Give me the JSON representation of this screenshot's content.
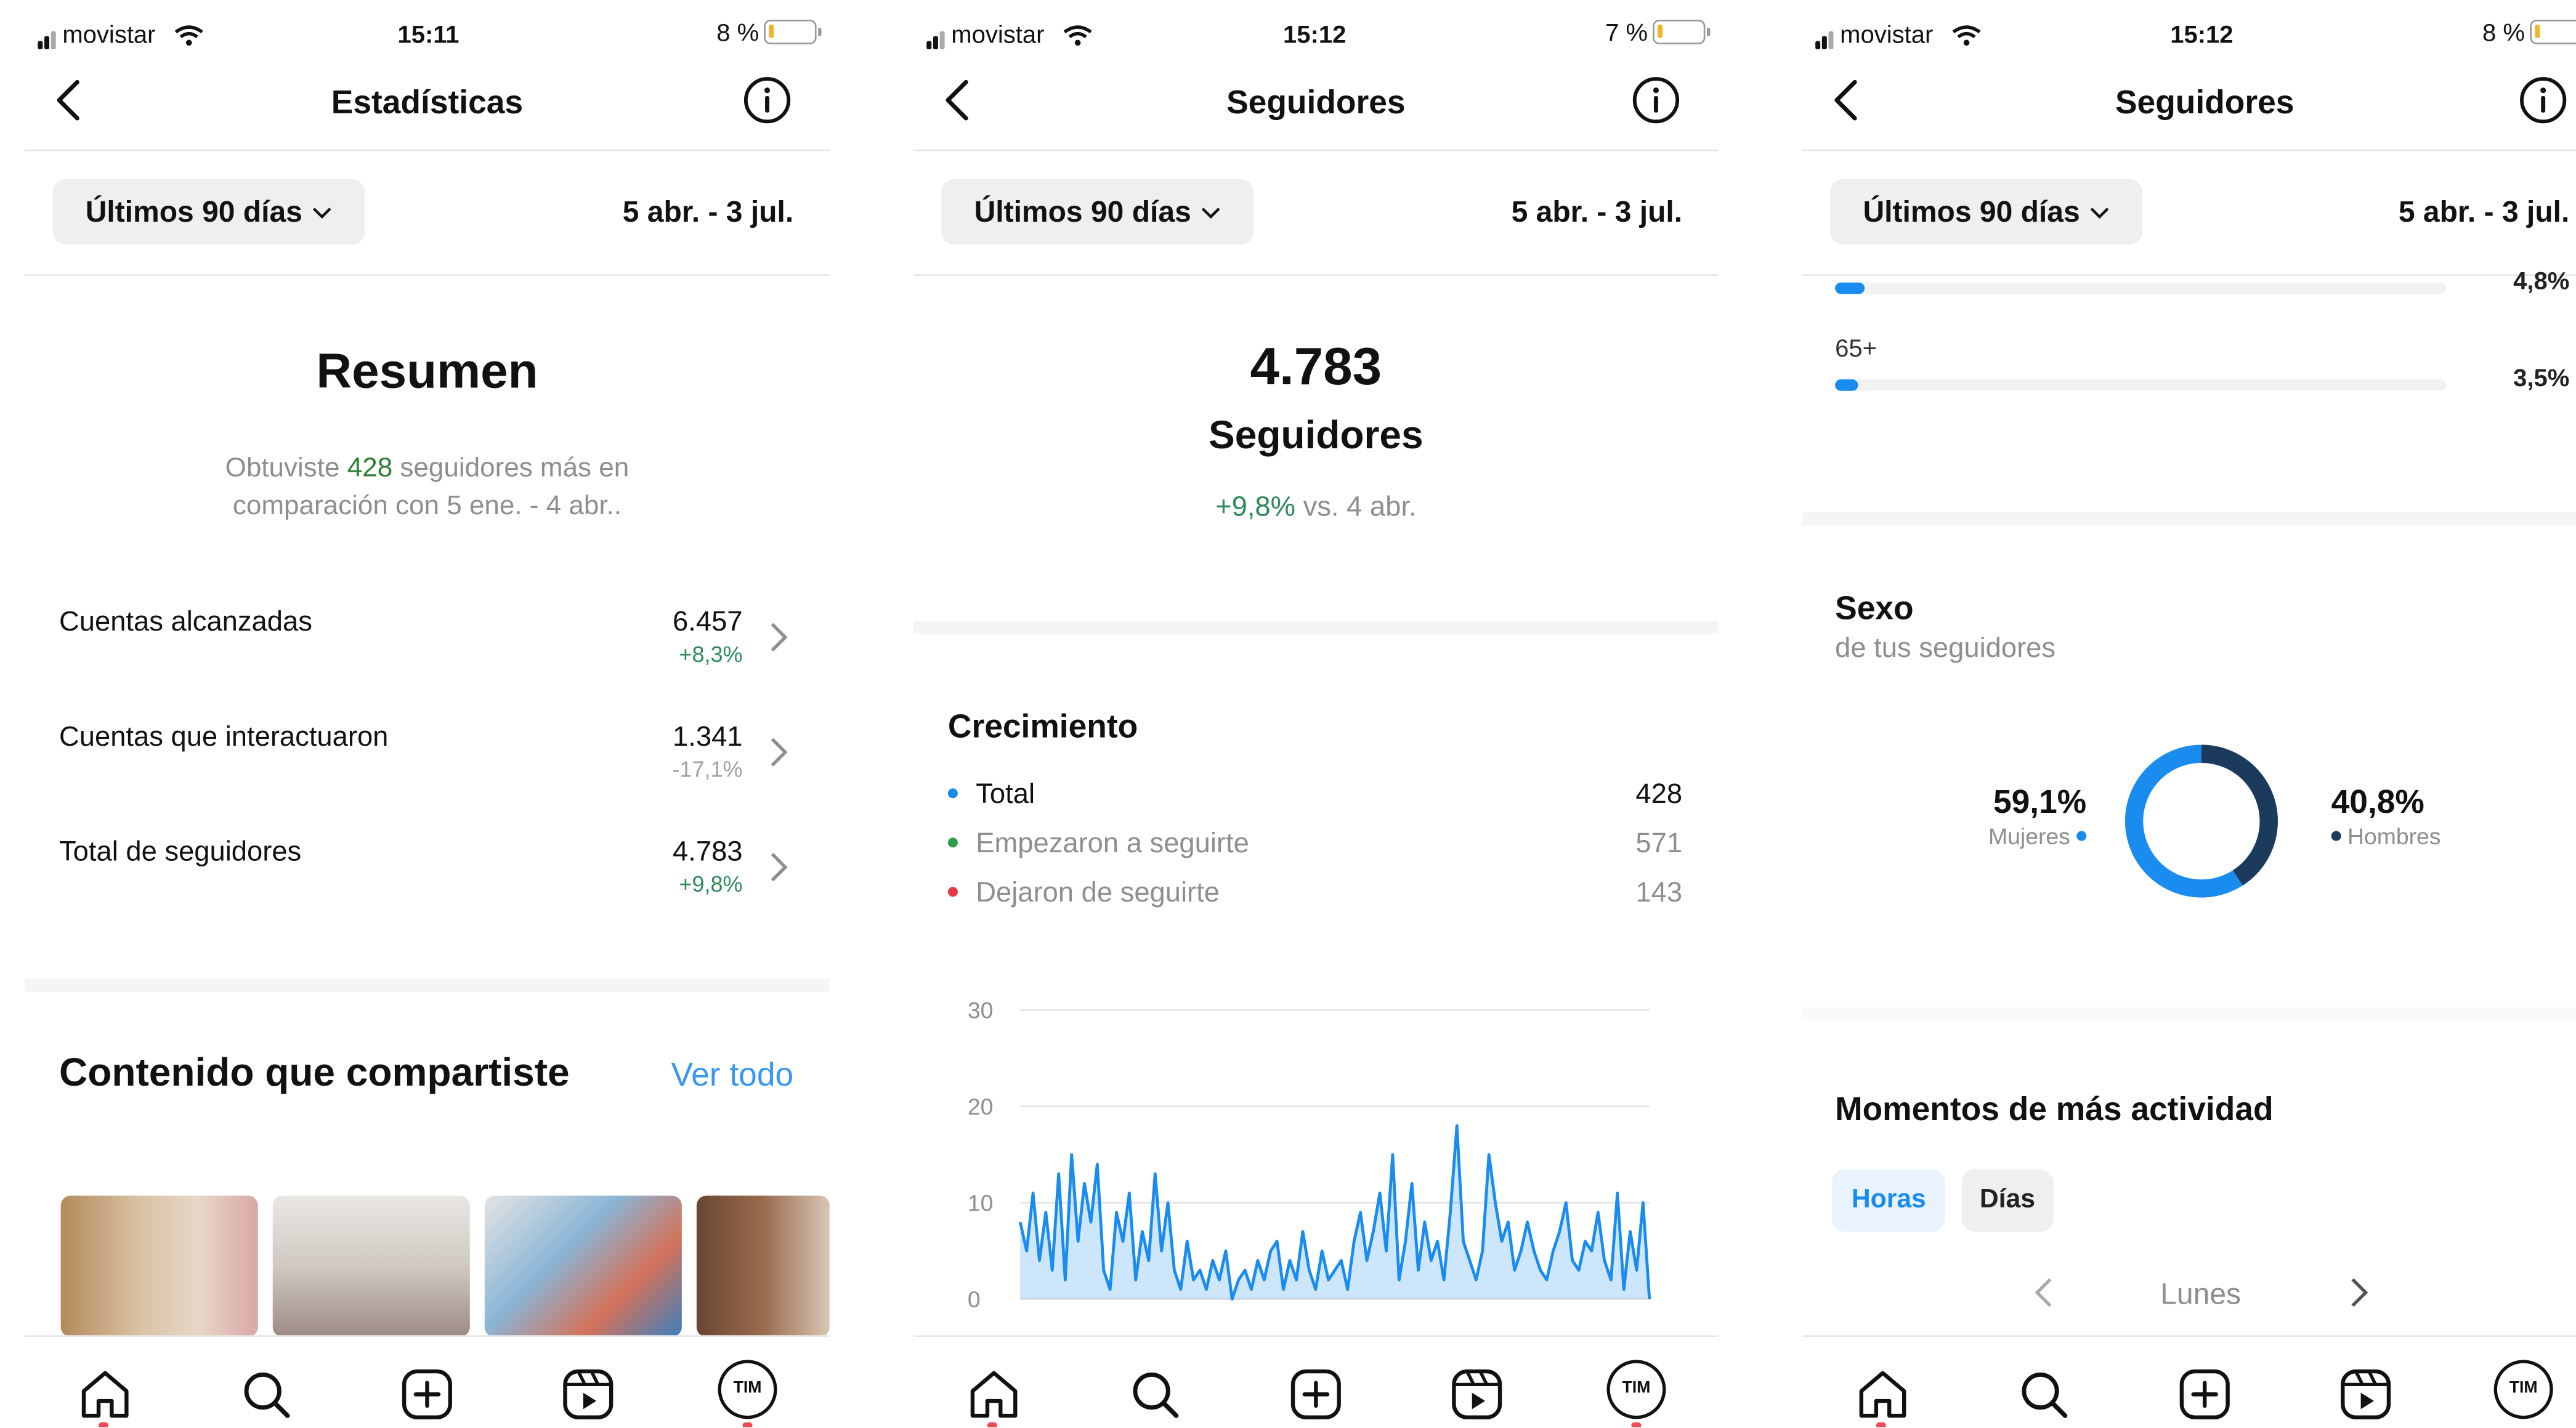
{
  "status_bars": [
    {
      "carrier": "movistar",
      "time": "15:11",
      "battery": "8 %"
    },
    {
      "carrier": "movistar",
      "time": "15:12",
      "battery": "7 %"
    },
    {
      "carrier": "movistar",
      "time": "15:12",
      "battery": "8 %"
    }
  ],
  "panel1": {
    "title": "Estadísticas",
    "range_label": "Últimos 90 días",
    "range_dates": "5 abr. - 3 jul.",
    "resumen_title": "Resumen",
    "summary_prefix": "Obtuviste ",
    "summary_highlight": "428",
    "summary_suffix": " seguidores más en",
    "summary_line2": "comparación con 5 ene. - 4 abr..",
    "metrics": [
      {
        "label": "Cuentas alcanzadas",
        "value": "6.457",
        "change": "+8,3%",
        "trend": "positive"
      },
      {
        "label": "Cuentas que interactuaron",
        "value": "1.341",
        "change": "-17,1%",
        "trend": "negative"
      },
      {
        "label": "Total de seguidores",
        "value": "4.783",
        "change": "+9,8%",
        "trend": "positive"
      }
    ],
    "content_title": "Contenido que compartiste",
    "see_all": "Ver todo"
  },
  "panel2": {
    "title": "Seguidores",
    "range_label": "Últimos 90 días",
    "range_dates": "5 abr. - 3 jul.",
    "followers_count": "4.783",
    "followers_label": "Seguidores",
    "change_highlight": "+9,8%",
    "change_suffix": " vs. 4 abr.",
    "growth_title": "Crecimiento",
    "growth_rows": [
      {
        "label": "Total",
        "value": "428",
        "color": "#1a8cf0",
        "emphasis": true
      },
      {
        "label": "Empezaron a seguirte",
        "value": "571",
        "color": "#2e9d4a",
        "emphasis": false
      },
      {
        "label": "Dejaron de seguirte",
        "value": "143",
        "color": "#e53946",
        "emphasis": false
      }
    ]
  },
  "panel3": {
    "title": "Seguidores",
    "range_label": "Últimos 90 días",
    "range_dates": "5 abr. - 3 jul.",
    "age_rows": [
      {
        "label": "",
        "value": "4,8%",
        "fraction": 0.048
      },
      {
        "label": "65+",
        "value": "3,5%",
        "fraction": 0.035
      }
    ],
    "sex_title": "Sexo",
    "sex_subtitle": "de tus seguidores",
    "women_pct": "59,1%",
    "women_label": "Mujeres",
    "men_pct": "40,8%",
    "men_label": "Hombres",
    "moments_title": "Momentos de más actividad",
    "tab_hours": "Horas",
    "tab_days": "Días",
    "day_label": "Lunes"
  },
  "tab_bar": {
    "icons": [
      "home-icon",
      "search-icon",
      "new-post-icon",
      "reels-icon",
      "profile-icon"
    ],
    "profile_text": "TIM"
  },
  "chart_data": {
    "type": "area",
    "title": "",
    "xlabel": "",
    "ylabel": "",
    "ylim": [
      0,
      30
    ],
    "yticks": [
      0,
      10,
      20,
      30
    ],
    "grid": true,
    "series": [
      {
        "color": "#1a8cf0",
        "values": [
          8,
          5,
          11,
          4,
          9,
          3,
          13,
          2,
          15,
          6,
          12,
          8,
          14,
          3,
          1,
          9,
          6,
          11,
          2,
          7,
          4,
          13,
          5,
          10,
          3,
          1,
          6,
          2,
          3,
          1,
          4,
          2,
          5,
          0,
          2,
          3,
          1,
          4,
          2,
          5,
          6,
          1,
          4,
          2,
          7,
          3,
          1,
          5,
          2,
          3,
          4,
          1,
          6,
          9,
          4,
          7,
          11,
          5,
          15,
          2,
          6,
          12,
          3,
          8,
          4,
          6,
          2,
          9,
          18,
          6,
          4,
          2,
          5,
          15,
          10,
          6,
          8,
          3,
          5,
          8,
          5,
          3,
          2,
          5,
          7,
          10,
          4,
          3,
          6,
          5,
          9,
          4,
          2,
          11,
          1,
          7,
          3,
          10,
          0
        ]
      }
    ]
  }
}
